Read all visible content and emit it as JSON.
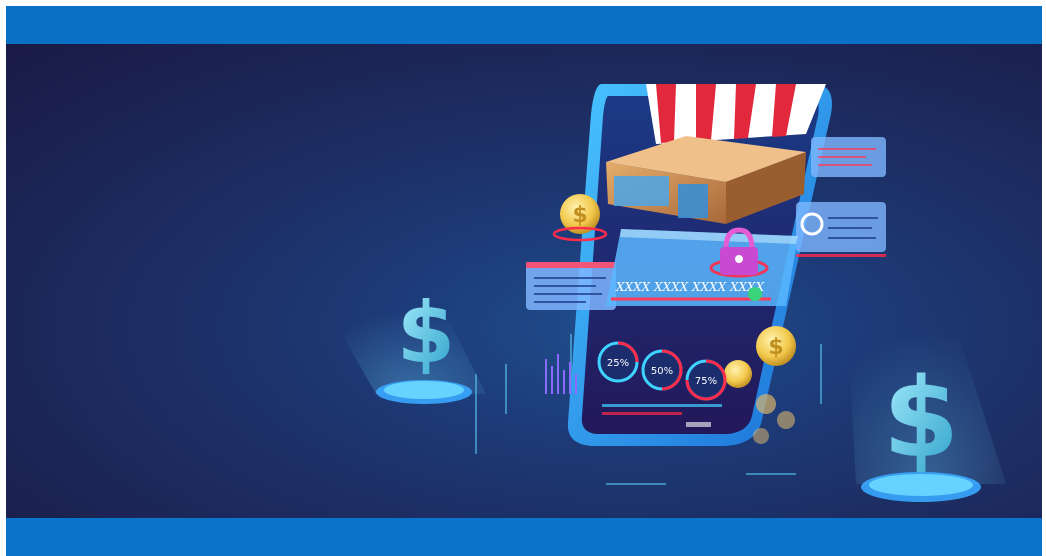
{
  "banner": {
    "card_number": "XXXX  XXXX  XXXX  XXXX",
    "stats": [
      {
        "label": "25%"
      },
      {
        "label": "50%"
      },
      {
        "label": "75%"
      }
    ],
    "colors": {
      "top_bar": "#0a70c6",
      "bottom_bar": "#0a74ca",
      "background_dark": "#1a1a45",
      "background_light": "#1f4f8c",
      "accent_cyan": "#3fd3ff",
      "accent_red": "#ff2b4a",
      "gold": "#f2c94c"
    },
    "icons": [
      "dollar-sign-icon",
      "padlock-icon",
      "shop-awning-icon",
      "package-box-icon",
      "coin-icon"
    ]
  }
}
